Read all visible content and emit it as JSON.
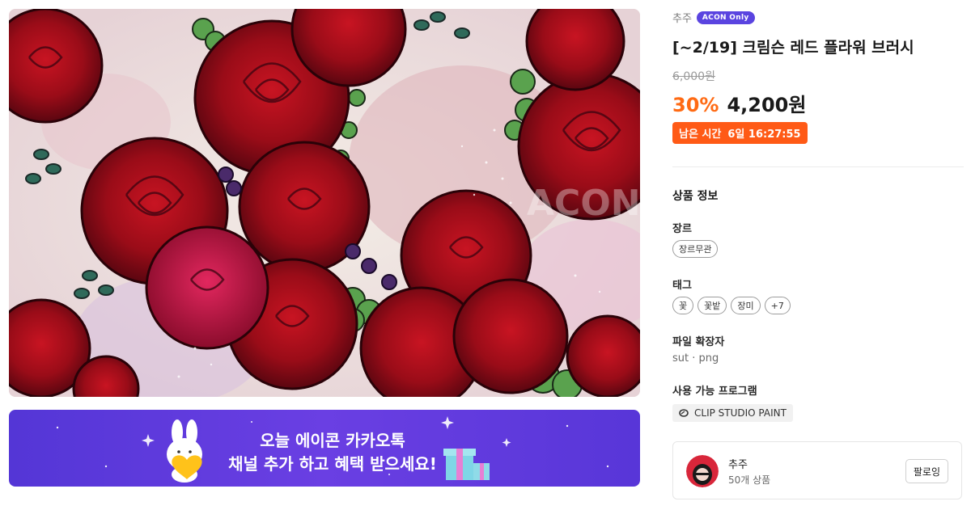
{
  "product": {
    "brand": "추주",
    "badge": "ACON Only",
    "title": "[~2/19] 크림슨 레드 플라워 브러시",
    "original_price": "6,000원",
    "discount": "30%",
    "price": "4,200원",
    "timer_label": "남은 시간",
    "timer_value": "6일 16:27:55",
    "watermark": "ACON"
  },
  "info": {
    "section_title": "상품 정보",
    "genre_label": "장르",
    "genre_chips": [
      "장르무관"
    ],
    "tag_label": "태그",
    "tag_chips": [
      "꽃",
      "꽃밭",
      "장미",
      "+7"
    ],
    "ext_label": "파일 확장자",
    "ext_value": "sut · png",
    "program_label": "사용 가능 프로그램",
    "program_name": "CLIP STUDIO PAINT"
  },
  "seller": {
    "name": "추주",
    "count": "50개 상품",
    "follow_label": "팔로잉"
  },
  "banner": {
    "line1": "오늘 에이콘 카카오톡",
    "line2": "채널 추가 하고 혜택 받으세요!"
  },
  "colors": {
    "accent_orange": "#ff6a13",
    "timer_bg": "#ff5a16",
    "badge_purple": "#5a44e0",
    "banner_purple": "#5a38dc"
  }
}
